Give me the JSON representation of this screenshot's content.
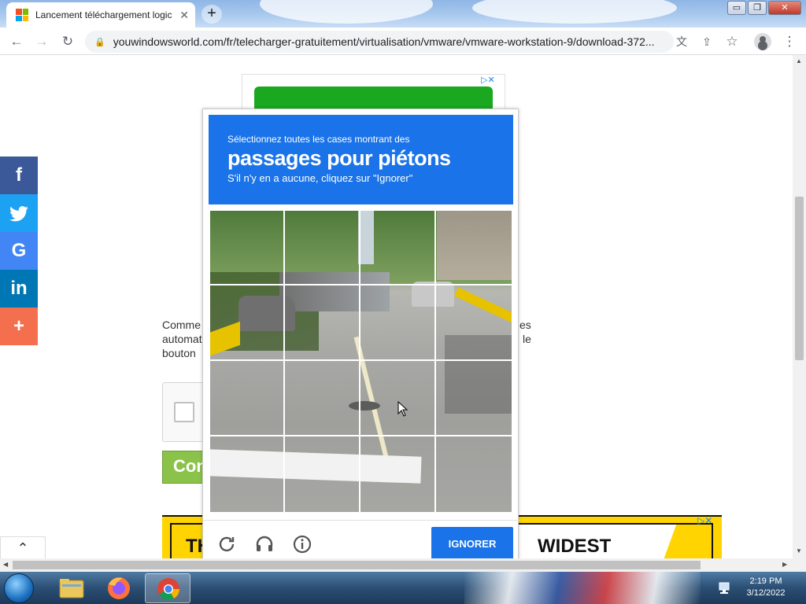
{
  "browser": {
    "tab_title": "Lancement téléchargement logic",
    "tab_close": "✕",
    "new_tab": "+",
    "url": "youwindowsworld.com/fr/telecharger-gratuitement/virtualisation/vmware/vmware-workstation-9/download-372...",
    "window_controls": {
      "minimize": "▭",
      "maximize": "❐",
      "close": "✕"
    }
  },
  "page": {
    "article_lines": [
      "Comme",
      "automat",
      "bouton"
    ],
    "article_right_lines": [
      "es",
      "le"
    ],
    "continue_label": "Con",
    "ad_bottom_left": "TH",
    "ad_bottom_right": "WIDEST",
    "ad_choices": "▷✕",
    "scroll_top": "⌃"
  },
  "social": [
    {
      "name": "facebook",
      "label": "f",
      "color": "#3b5998"
    },
    {
      "name": "twitter",
      "label": "🐦",
      "color": "#1da1f2"
    },
    {
      "name": "google",
      "label": "G",
      "color": "#4285f4"
    },
    {
      "name": "linkedin",
      "label": "in",
      "color": "#0077b5"
    },
    {
      "name": "more",
      "label": "+",
      "color": "#f36f4e"
    }
  ],
  "captcha": {
    "instruction": "Sélectionnez toutes les cases montrant des",
    "target": "passages pour piétons",
    "sub": "S'il n'y en a aucune, cliquez sur \"Ignorer\"",
    "button": "IGNORER",
    "grid_size": "4x4"
  },
  "taskbar": {
    "time": "2:19 PM",
    "date": "3/12/2022",
    "apps": [
      "file-explorer",
      "firefox",
      "chrome"
    ]
  },
  "colors": {
    "captcha_blue": "#1a73e8",
    "continue_green": "#8bc34a",
    "ad_yellow": "#ffd400"
  }
}
